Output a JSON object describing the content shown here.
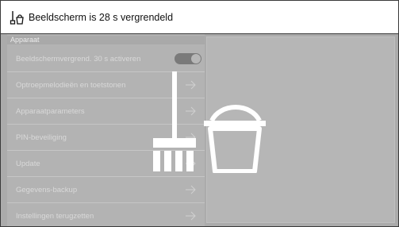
{
  "header": {
    "title": "Beeldscherm is 28 s vergrendeld",
    "icon": "clean-lock-icon"
  },
  "menu": {
    "section_label": "Apparaat",
    "items": [
      {
        "label": "Beeldschermvergrend. 30 s activeren",
        "control": "toggle",
        "toggle_on": true
      },
      {
        "label": "Optroepmelodieën en toetstonen",
        "control": "chevron"
      },
      {
        "label": "Apparaatparameters",
        "control": "chevron"
      },
      {
        "label": "PIN-beveiliging",
        "control": "chevron"
      },
      {
        "label": "Update",
        "control": "chevron"
      },
      {
        "label": "Gegevens-backup",
        "control": "chevron"
      },
      {
        "label": "Instellingen terugzetten",
        "control": "chevron"
      }
    ]
  },
  "overlay": {
    "icon": "broom-bucket-icon"
  },
  "colors": {
    "overlay_bg": "#ababab",
    "text_dim": "#d9d9d9",
    "icon_white": "#ffffff"
  }
}
